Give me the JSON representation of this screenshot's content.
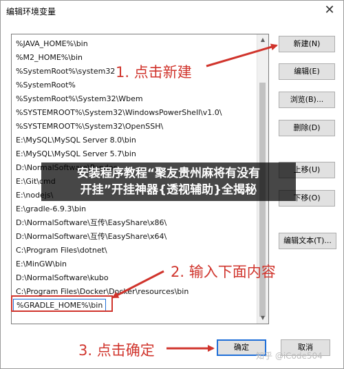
{
  "window": {
    "title": "编辑环境变量",
    "close_glyph": "✕"
  },
  "path_list": {
    "items": [
      "%JAVA_HOME%\\bin",
      "%M2_HOME%\\bin",
      "%SystemRoot%\\system32",
      "%SystemRoot%",
      "%SystemRoot%\\System32\\Wbem",
      "%SYSTEMROOT%\\System32\\WindowsPowerShell\\v1.0\\",
      "%SYSTEMROOT%\\System32\\OpenSSH\\",
      "E:\\MySQL\\MySQL Server 8.0\\bin",
      "E:\\MySQL\\MySQL Server 5.7\\bin",
      "D:\\NormalSoftware\\Pandoc",
      "E:\\Git\\cmd",
      "E:\\nodejs\\",
      "E:\\gradle-6.9.3\\bin",
      "D:\\NormalSoftware\\互传\\EasyShare\\x86\\",
      "D:\\NormalSoftware\\互传\\EasyShare\\x64\\",
      "C:\\Program Files\\dotnet\\",
      "E:\\MinGW\\bin",
      "D:\\NormalSoftware\\kubo",
      "C:\\Program Files\\Docker\\Docker\\resources\\bin",
      "%GRADLE_HOME%\\bin"
    ],
    "selected_index": 19
  },
  "buttons": {
    "new": "新建(N)",
    "edit": "编辑(E)",
    "browse": "浏览(B)...",
    "delete": "删除(D)",
    "move_up": "上移(U)",
    "move_down": "下移(O)",
    "edit_text": "编辑文本(T)...",
    "ok": "确定",
    "cancel": "取消"
  },
  "annotations": {
    "step1": "1. 点击新建",
    "step2": "2. 输入下面内容",
    "step3": "3. 点击确定",
    "color": "#d0342c"
  },
  "overlay": {
    "line1": "安装程序教程“聚友贵州麻将有没有",
    "line2": "开挂”开挂神器{透视辅助}全揭秘"
  },
  "watermark": "知乎 @iCode504"
}
